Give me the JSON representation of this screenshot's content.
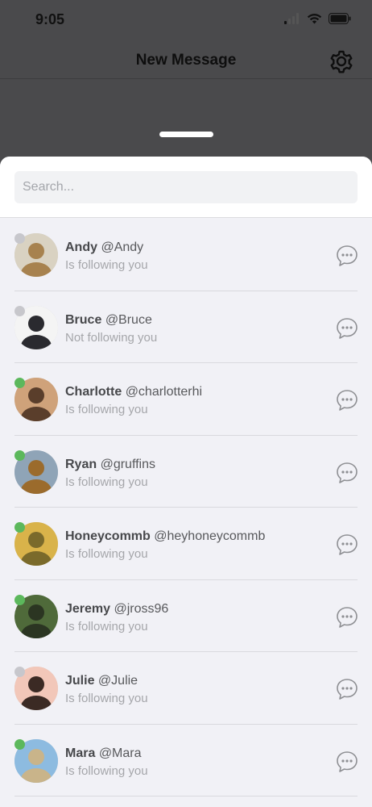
{
  "status": {
    "time": "9:05"
  },
  "header": {
    "title": "New Message"
  },
  "search": {
    "placeholder": "Search..."
  },
  "colors": {
    "online": "#5cb85c",
    "offline": "#c7c7cc"
  },
  "contacts": [
    {
      "name": "Andy",
      "handle": "@Andy",
      "status": "Is following you",
      "online": false,
      "avatar_colors": [
        "#d9d2c2",
        "#a7824f"
      ]
    },
    {
      "name": "Bruce",
      "handle": "@Bruce",
      "status": "Not following you",
      "online": false,
      "avatar_colors": [
        "#f4f4f4",
        "#2a2a2f"
      ]
    },
    {
      "name": "Charlotte",
      "handle": "@charlotterhi",
      "status": "Is following you",
      "online": true,
      "avatar_colors": [
        "#cfa27a",
        "#5a3e2b"
      ]
    },
    {
      "name": "Ryan",
      "handle": "@gruffins",
      "status": "Is following you",
      "online": true,
      "avatar_colors": [
        "#8fa4b7",
        "#9b6b2c"
      ]
    },
    {
      "name": "Honeycommb",
      "handle": "@heyhoneycommb",
      "status": "Is following you",
      "online": true,
      "avatar_colors": [
        "#d9b34a",
        "#7a6a2b"
      ]
    },
    {
      "name": "Jeremy",
      "handle": "@jross96",
      "status": "Is following you",
      "online": true,
      "avatar_colors": [
        "#4f6a3a",
        "#2b3522"
      ]
    },
    {
      "name": "Julie",
      "handle": "@Julie",
      "status": "Is following you",
      "online": false,
      "avatar_colors": [
        "#f2c7b9",
        "#3b2a24"
      ]
    },
    {
      "name": "Mara",
      "handle": "@Mara",
      "status": "Is following you",
      "online": true,
      "avatar_colors": [
        "#8dbbe0",
        "#c9b48a"
      ]
    }
  ]
}
